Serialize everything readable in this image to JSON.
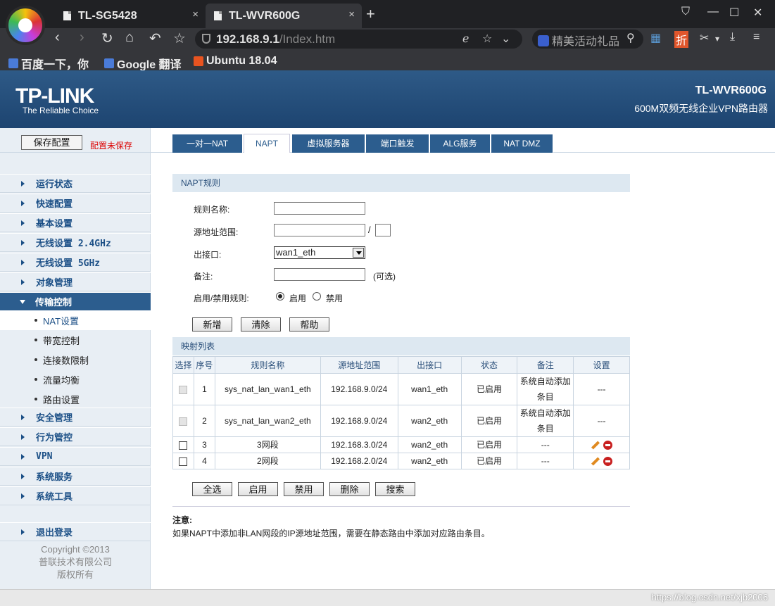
{
  "browser": {
    "tabs": [
      {
        "title": "TL-SG5428",
        "close": "×"
      },
      {
        "title": "TL-WVR600G",
        "close": "×"
      }
    ],
    "new_tab": "+",
    "window_controls": {
      "minimize": "—",
      "maximize": "☐",
      "close": "✕",
      "shirt": "⛉"
    },
    "nav": {
      "back": "‹",
      "forward": "›",
      "reload": "↻",
      "home": "⌂",
      "undo": "↶",
      "star": "☆"
    },
    "url_host": "192.168.9.1",
    "url_path": "/Index.htm",
    "url_icons": {
      "e": "ℯ",
      "fav": "☆",
      "down": "⌄"
    },
    "search_text": "精美活动礼品",
    "search_icon": "⚲",
    "toolbar_icons": {
      "apps": "▦",
      "discount": "折",
      "cut": "✂",
      "cut_down": "▾",
      "download": "⤓",
      "menu": "≡"
    },
    "bookmarks": [
      {
        "label": "百度一下，你"
      },
      {
        "label": "Google 翻译"
      },
      {
        "label": "Ubuntu 18.04"
      }
    ]
  },
  "header": {
    "logo": "TP-LINK",
    "tagline": "The Reliable Choice",
    "model": "TL-WVR600G",
    "subtitle": "600M双频无线企业VPN路由器"
  },
  "sidebar": {
    "save_button": "保存配置",
    "unsaved": "配置未保存",
    "menu": [
      {
        "label": "运行状态"
      },
      {
        "label": "快速配置"
      },
      {
        "label": "基本设置"
      },
      {
        "label": "无线设置 2.4GHz"
      },
      {
        "label": "无线设置 5GHz"
      },
      {
        "label": "对象管理"
      },
      {
        "label": "传输控制"
      }
    ],
    "submenu": [
      {
        "label": "NAT设置"
      },
      {
        "label": "带宽控制"
      },
      {
        "label": "连接数限制"
      },
      {
        "label": "流量均衡"
      },
      {
        "label": "路由设置"
      }
    ],
    "menu2": [
      {
        "label": "安全管理"
      },
      {
        "label": "行为管控"
      },
      {
        "label": "VPN"
      },
      {
        "label": "系统服务"
      },
      {
        "label": "系统工具"
      }
    ],
    "logout": "退出登录",
    "copyright": [
      "Copyright ©2013",
      "普联技术有限公司",
      "版权所有"
    ]
  },
  "tabs": [
    {
      "label": "一对一NAT"
    },
    {
      "label": "NAPT"
    },
    {
      "label": "虚拟服务器"
    },
    {
      "label": "端口触发"
    },
    {
      "label": "ALG服务"
    },
    {
      "label": "NAT DMZ"
    }
  ],
  "form": {
    "section_title": "NAPT规则",
    "rule_name_label": "规则名称:",
    "rule_name_value": "",
    "src_range_label": "源地址范围:",
    "slash": "/",
    "out_if_label": "出接口:",
    "out_if_value": "wan1_eth",
    "note_label": "备注:",
    "optional": "(可选)",
    "enable_label": "启用/禁用规则:",
    "enable": "启用",
    "disable": "禁用",
    "selected": "启用",
    "buttons": {
      "add": "新增",
      "clear": "清除",
      "help": "帮助"
    }
  },
  "table": {
    "section_title": "映射列表",
    "headers": [
      "选择",
      "序号",
      "规则名称",
      "源地址范围",
      "出接口",
      "状态",
      "备注",
      "设置"
    ],
    "rows": [
      {
        "seq": "1",
        "name": "sys_nat_lan_wan1_eth",
        "src": "192.168.9.0/24",
        "out": "wan1_eth",
        "status": "已启用",
        "note": "系统自动添加条目",
        "setting": "---"
      },
      {
        "seq": "2",
        "name": "sys_nat_lan_wan2_eth",
        "src": "192.168.9.0/24",
        "out": "wan2_eth",
        "status": "已启用",
        "note": "系统自动添加条目",
        "setting": "---"
      },
      {
        "seq": "3",
        "name": "3网段",
        "src": "192.168.3.0/24",
        "out": "wan2_eth",
        "status": "已启用",
        "note": "---",
        "setting": ""
      },
      {
        "seq": "4",
        "name": "2网段",
        "src": "192.168.2.0/24",
        "out": "wan2_eth",
        "status": "已启用",
        "note": "---",
        "setting": ""
      }
    ],
    "buttons": {
      "select_all": "全选",
      "enable": "启用",
      "disable": "禁用",
      "delete": "删除",
      "search": "搜索"
    }
  },
  "notes": {
    "title": "注意:",
    "text": "如果NAPT中添加非LAN网段的IP源地址范围，需要在静态路由中添加对应路由条目。"
  },
  "watermark": "https://blog.csdn.net/xjb2006"
}
